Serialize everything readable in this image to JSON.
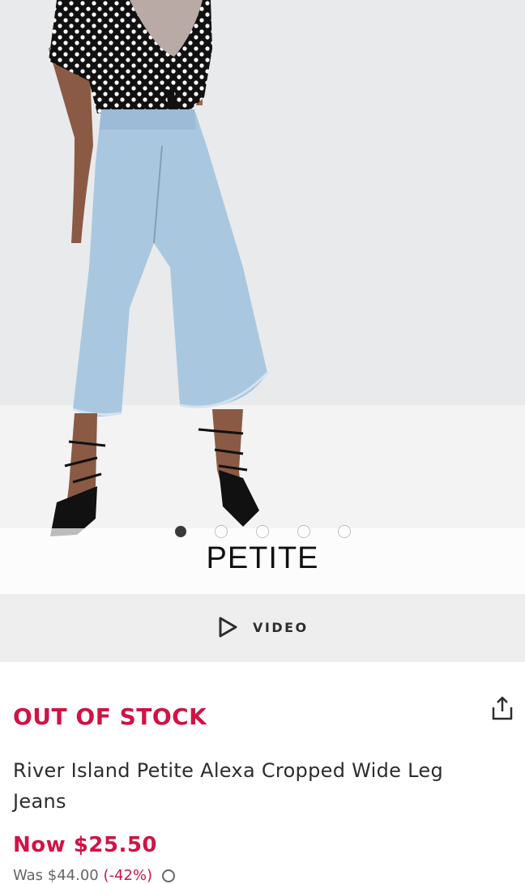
{
  "gallery": {
    "badge": "PETITE",
    "slide_count": 5,
    "active_slide": 1
  },
  "video": {
    "label": "VIDEO"
  },
  "product": {
    "stock_status": "OUT OF STOCK",
    "title": "River Island Petite Alexa Cropped Wide Leg Jeans",
    "price_now": "Now $25.50",
    "price_was": "Was $44.00",
    "discount": "(-42%)"
  },
  "colors": {
    "accent": "#d01345",
    "text": "#2d2d2d",
    "video_bar": "#eeeeee"
  },
  "icons": {
    "play": "play-outline-icon",
    "share": "share-icon",
    "info": "info-icon"
  }
}
